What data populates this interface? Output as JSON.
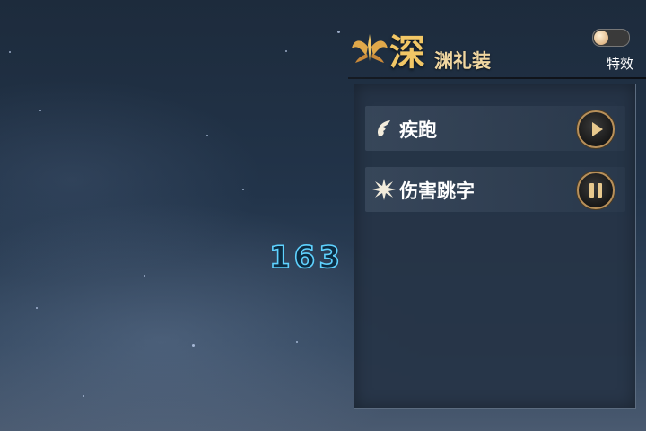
{
  "title": {
    "main": "深",
    "sub": "渊礼装"
  },
  "effects_toggle": {
    "label": "特效",
    "on": false
  },
  "damage_number": "163",
  "items": [
    {
      "label": "疾跑",
      "icon": "feather-boot-icon",
      "button": "play-icon"
    },
    {
      "label": "伤害跳字",
      "icon": "burst-icon",
      "button": "pause-icon"
    }
  ],
  "colors": {
    "title_gold": "#f2c766",
    "button_ring": "#b8905a",
    "damage_glow": "#5fd2ff"
  }
}
